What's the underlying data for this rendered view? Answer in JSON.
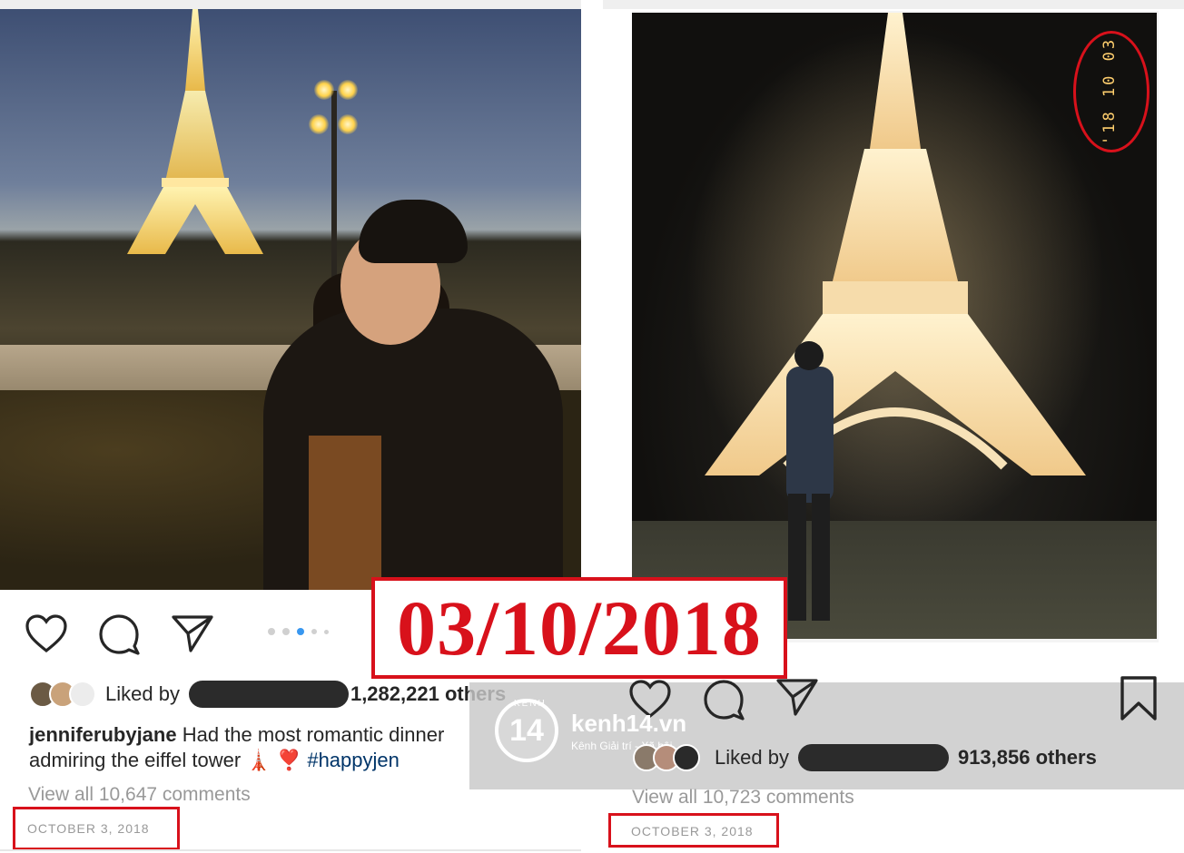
{
  "left_post": {
    "likes": {
      "prefix": "Liked by",
      "count": "1,282,221 others"
    },
    "caption": {
      "username": "jenniferubyjane",
      "text": "Had the most romantic dinner admiring the eiffel tower",
      "emoji": "🗼 ❣️",
      "hashtag": "#happyjen"
    },
    "comments_link": "View all 10,647 comments",
    "date": "OCTOBER 3, 2018",
    "carousel": {
      "total": 5,
      "active_index": 2
    }
  },
  "right_post": {
    "photo_stamp": "'18 10 03",
    "likes": {
      "prefix": "Liked by",
      "count": "913,856 others"
    },
    "comments_link": "View all 10,723 comments",
    "date": "OCTOBER 3, 2018"
  },
  "annotation": {
    "big_date": "03/10/2018"
  },
  "watermark": {
    "logo_text": "14",
    "kenh_label": "KENH",
    "site": "kenh14.vn",
    "tagline": "Kênh Giải trí - Xã hội"
  },
  "colors": {
    "annotation_red": "#d8111b",
    "hashtag_blue": "#003569",
    "carousel_active": "#3897f0",
    "muted_text": "#999999"
  },
  "icons": [
    "heart-icon",
    "comment-icon",
    "share-icon",
    "bookmark-icon"
  ]
}
